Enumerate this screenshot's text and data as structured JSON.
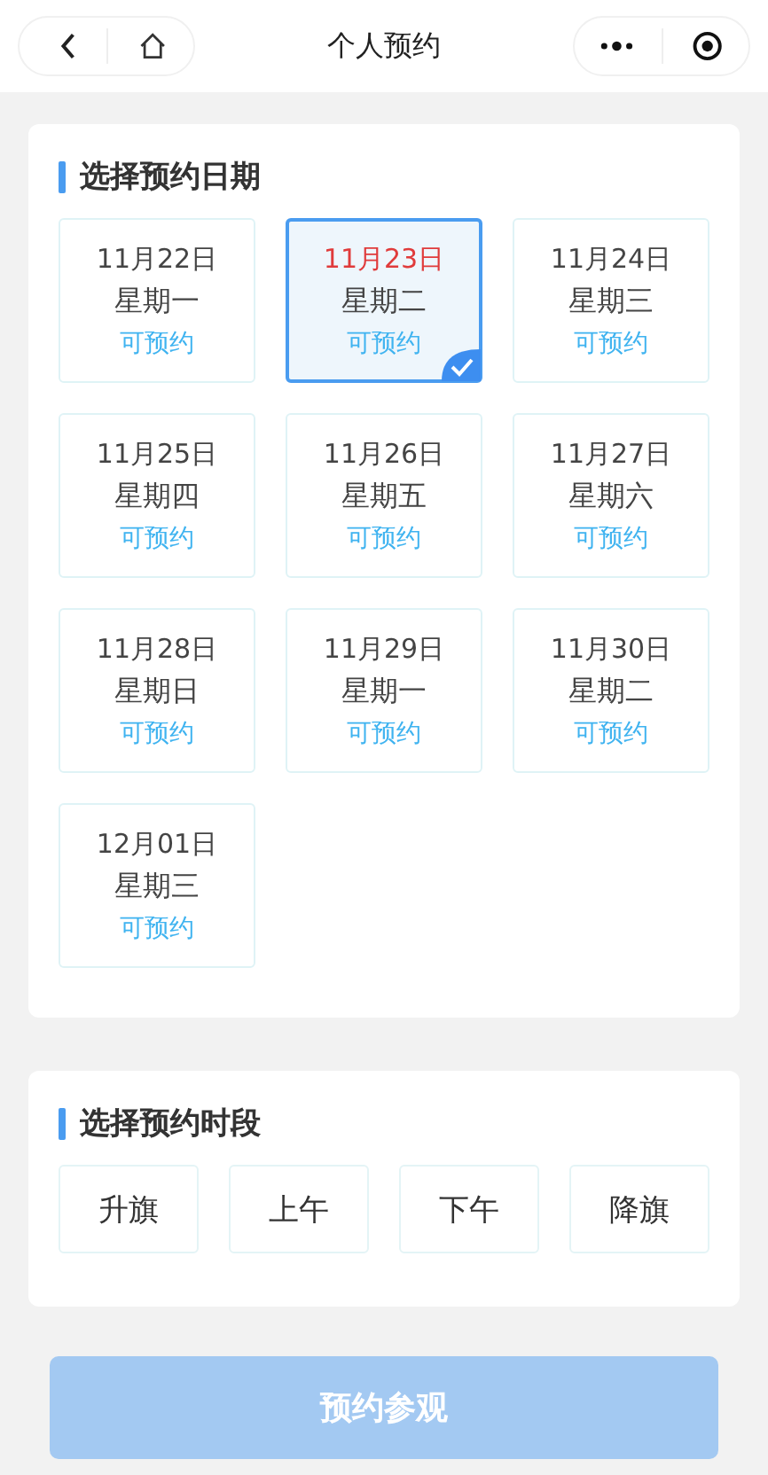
{
  "nav": {
    "title": "个人预约"
  },
  "date_section": {
    "title": "选择预约日期",
    "dates": [
      {
        "date": "11月22日",
        "weekday": "星期一",
        "status": "可预约",
        "selected": false
      },
      {
        "date": "11月23日",
        "weekday": "星期二",
        "status": "可预约",
        "selected": true
      },
      {
        "date": "11月24日",
        "weekday": "星期三",
        "status": "可预约",
        "selected": false
      },
      {
        "date": "11月25日",
        "weekday": "星期四",
        "status": "可预约",
        "selected": false
      },
      {
        "date": "11月26日",
        "weekday": "星期五",
        "status": "可预约",
        "selected": false
      },
      {
        "date": "11月27日",
        "weekday": "星期六",
        "status": "可预约",
        "selected": false
      },
      {
        "date": "11月28日",
        "weekday": "星期日",
        "status": "可预约",
        "selected": false
      },
      {
        "date": "11月29日",
        "weekday": "星期一",
        "status": "可预约",
        "selected": false
      },
      {
        "date": "11月30日",
        "weekday": "星期二",
        "status": "可预约",
        "selected": false
      },
      {
        "date": "12月01日",
        "weekday": "星期三",
        "status": "可预约",
        "selected": false
      }
    ]
  },
  "time_section": {
    "title": "选择预约时段",
    "slots": [
      {
        "label": "升旗",
        "selected": false
      },
      {
        "label": "上午",
        "selected": false
      },
      {
        "label": "下午",
        "selected": false
      },
      {
        "label": "降旗",
        "selected": false
      }
    ]
  },
  "submit": {
    "label": "预约参观",
    "disabled": true
  }
}
